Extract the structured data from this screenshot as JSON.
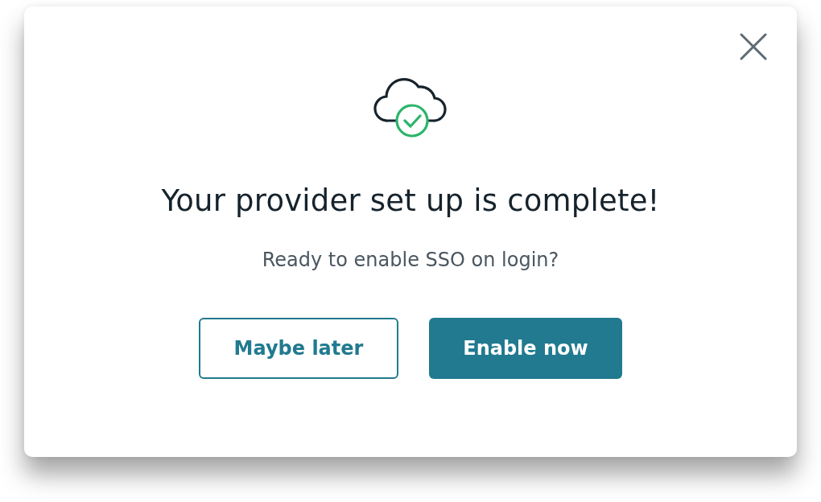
{
  "dialog": {
    "title": "Your provider set up is complete!",
    "message": "Ready to enable SSO on login?",
    "buttons": [
      {
        "label": "Maybe later",
        "kind": "secondary"
      },
      {
        "label": "Enable now",
        "kind": "primary"
      }
    ]
  }
}
